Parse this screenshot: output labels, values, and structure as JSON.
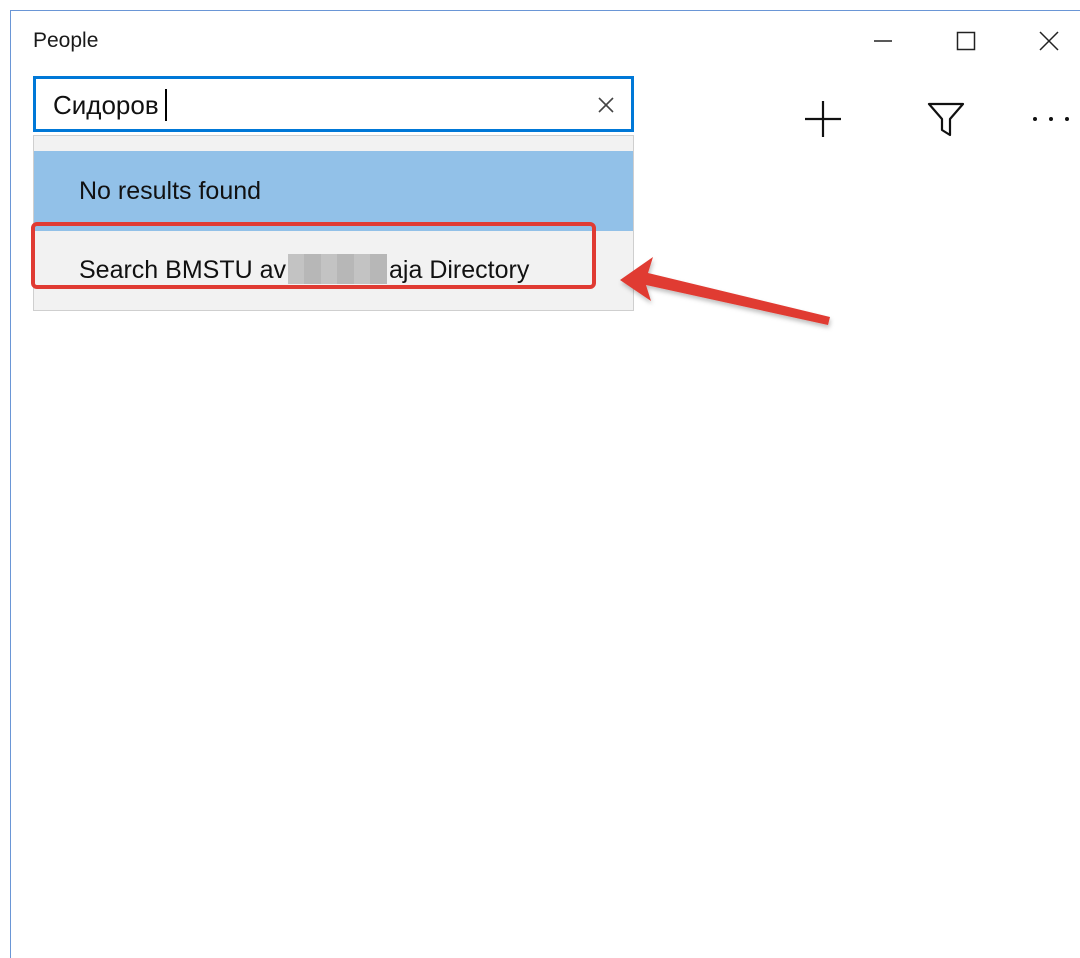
{
  "window": {
    "title": "People"
  },
  "search": {
    "value": "Сидоров",
    "clear_icon": "close-icon"
  },
  "toolbar": {
    "add_icon": "plus-icon",
    "filter_icon": "filter-icon",
    "more_icon": "more-icon"
  },
  "dropdown": {
    "no_results": "No results found",
    "search_directory_prefix": "Search BMSTU av",
    "search_directory_suffix": "aja Directory"
  },
  "colors": {
    "accent": "#0078d7",
    "selected_row": "#92c1e8",
    "annotation": "#e03b33"
  }
}
